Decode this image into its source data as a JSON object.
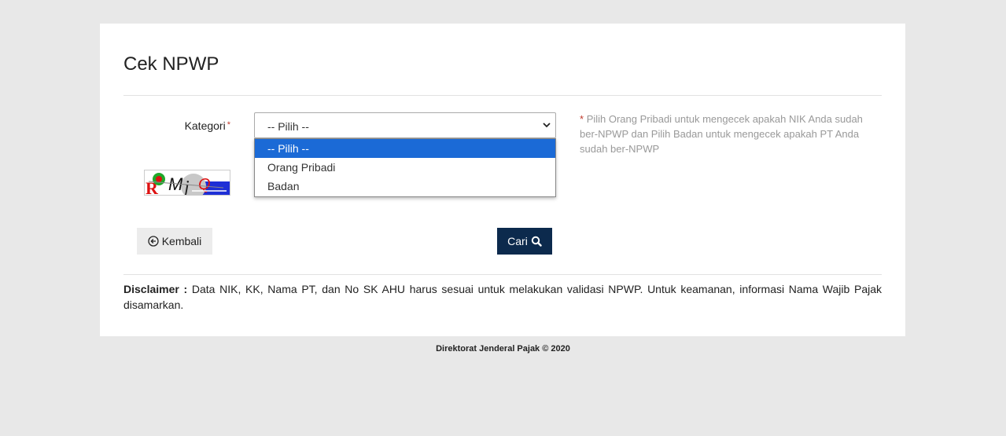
{
  "page": {
    "title": "Cek NPWP"
  },
  "form": {
    "kategori_label": "Kategori",
    "required_mark": "*",
    "select_value": "-- Pilih --",
    "options": [
      "-- Pilih --",
      "Orang Pribadi",
      "Badan"
    ],
    "hint_star": "*",
    "hint_text": "Pilih Orang Pribadi untuk mengecek apakah NIK Anda sudah ber-NPWP dan Pilih Badan untuk mengecek apakah PT Anda sudah ber-NPWP",
    "captcha_text": "RMjQ"
  },
  "buttons": {
    "back_label": "Kembali",
    "back_icon": "arrow-circle-left-icon",
    "search_label": "Cari",
    "search_icon": "search-icon",
    "search_color": "#0c2a4d"
  },
  "disclaimer": {
    "heading": "Disclaimer :",
    "text": "Data NIK, KK, Nama PT, dan No SK AHU harus sesuai untuk melakukan validasi NPWP. Untuk keamanan, informasi Nama Wajib Pajak disamarkan."
  },
  "footer": {
    "text": "Direktorat Jenderal Pajak © 2020"
  },
  "colors": {
    "selected_option": "#1b6ad6",
    "required": "#c0392b"
  }
}
